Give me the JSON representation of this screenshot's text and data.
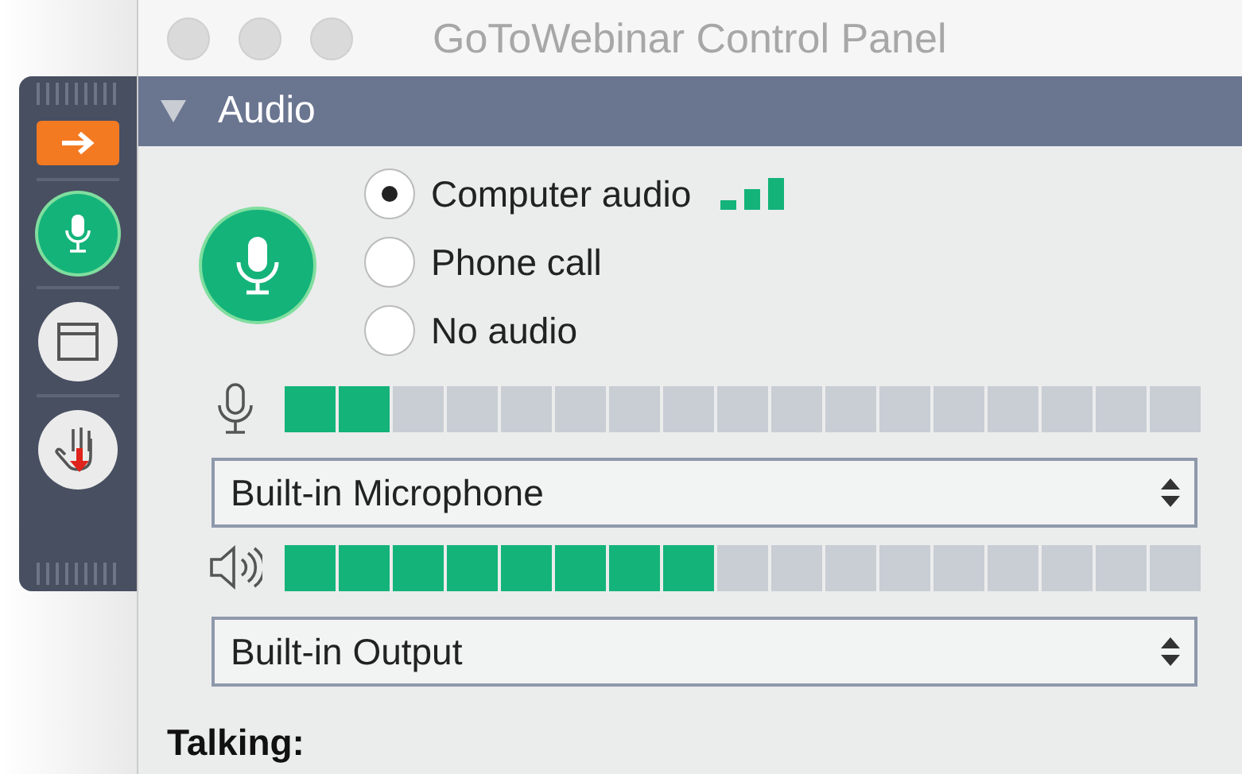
{
  "window": {
    "title": "GoToWebinar Control Panel"
  },
  "sidebar": {
    "items": [
      {
        "kind": "arrow",
        "active": false
      },
      {
        "kind": "mic",
        "active": true
      },
      {
        "kind": "window",
        "active": false
      },
      {
        "kind": "hand",
        "active": false
      }
    ]
  },
  "section": {
    "title": "Audio",
    "expanded": true
  },
  "audio_modes": [
    {
      "label": "Computer audio",
      "selected": true,
      "signal": true
    },
    {
      "label": "Phone call",
      "selected": false,
      "signal": false
    },
    {
      "label": "No audio",
      "selected": false,
      "signal": false
    }
  ],
  "devices": [
    {
      "kind": "mic",
      "level": 0.118,
      "device": "Built-in Microphone"
    },
    {
      "kind": "speaker",
      "level": 0.47,
      "device": "Built-in Output"
    }
  ],
  "talking_label": "Talking:"
}
